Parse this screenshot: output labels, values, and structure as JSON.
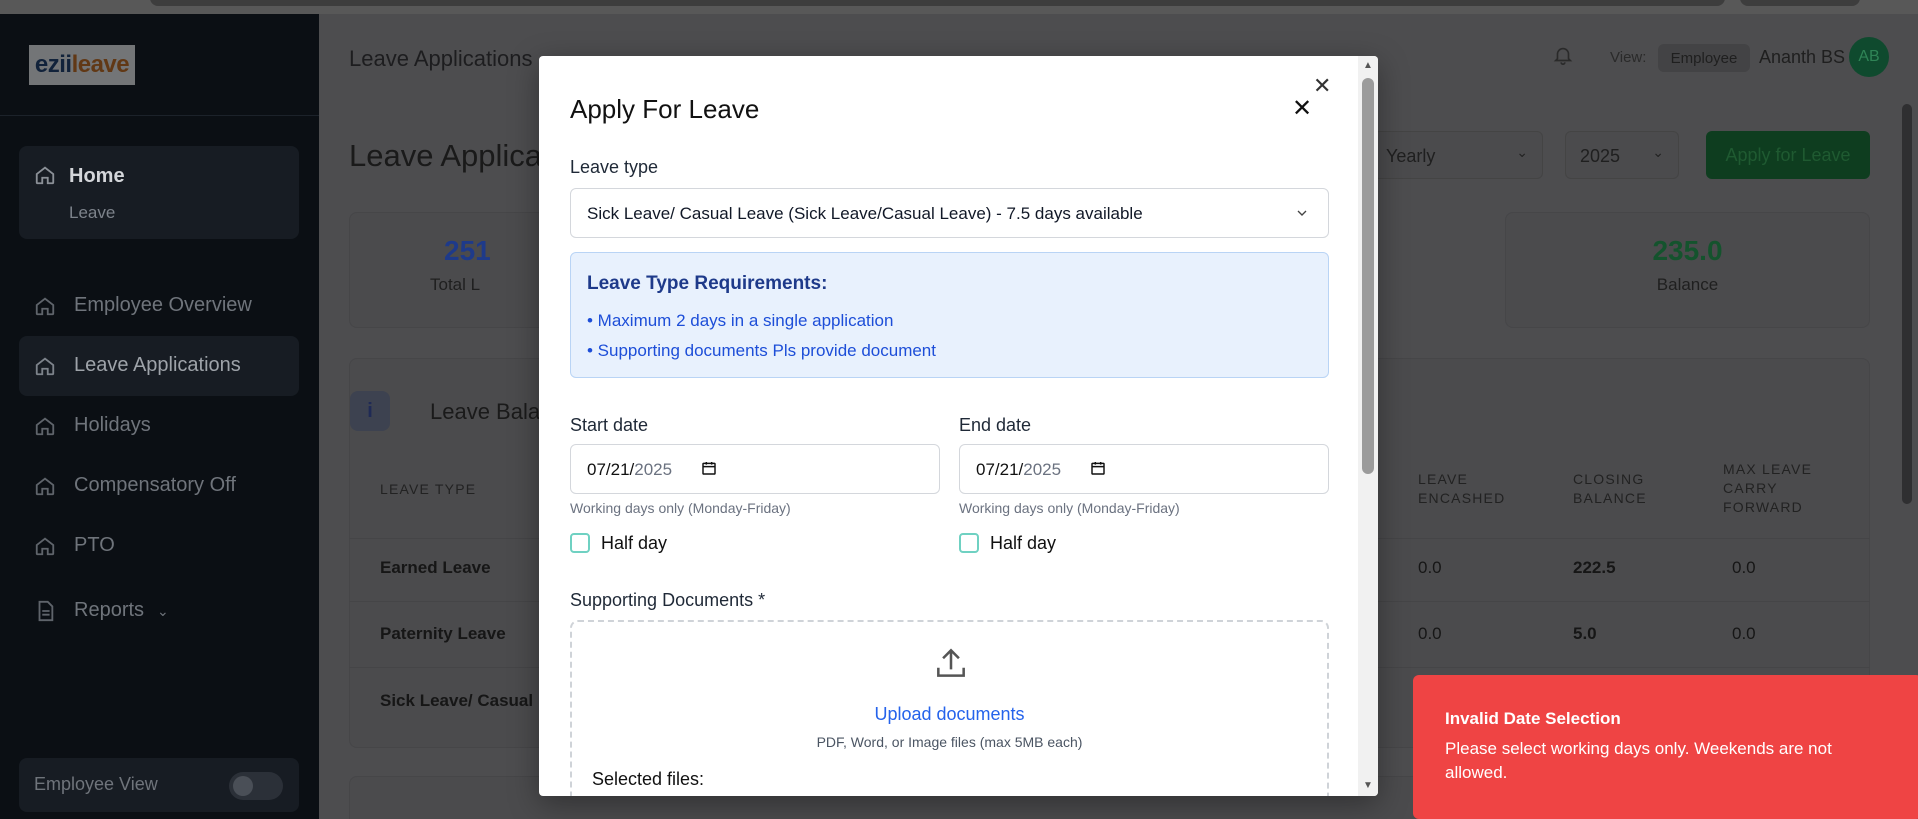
{
  "app": {
    "logo_text": "ezii",
    "logo_accent": "leave"
  },
  "sidebar": {
    "home_label": "Home",
    "home_sub": "Leave",
    "items": [
      {
        "label": "Employee Overview",
        "icon": "home-icon"
      },
      {
        "label": "Leave Applications",
        "icon": "home-icon"
      },
      {
        "label": "Holidays",
        "icon": "home-icon"
      },
      {
        "label": "Compensatory Off",
        "icon": "home-icon"
      },
      {
        "label": "PTO",
        "icon": "home-icon"
      },
      {
        "label": "Reports",
        "icon": "document-icon"
      }
    ],
    "employee_view_label": "Employee View"
  },
  "header": {
    "title": "Leave Applications",
    "view_label": "View:",
    "view_value": "Employee",
    "user_name": "Ananth BS",
    "avatar_initials": "AB"
  },
  "page": {
    "title": "Leave Applicat",
    "period_select": "Yearly",
    "year_select": "2025",
    "apply_button": "Apply for Leave",
    "stats": [
      {
        "value": "251",
        "label": "Total L",
        "color": "#1e3a8a"
      },
      {
        "value": "235.0",
        "label": "Balance",
        "color": "#14532d"
      }
    ],
    "balance_panel_title": "Leave Balan",
    "columns": [
      "LEAVE TYPE",
      "LEAVE ENCASHED",
      "CLOSING BALANCE",
      "MAX LEAVE CARRY FORWARD"
    ],
    "rows": [
      {
        "type": "Earned Leave",
        "encashed": "0.0",
        "closing": "222.5",
        "carry": "0.0"
      },
      {
        "type": "Paternity Leave",
        "encashed": "0.0",
        "closing": "5.0",
        "carry": "0.0"
      },
      {
        "type": "Sick Leave/ Casual L",
        "encashed": "",
        "closing": "",
        "carry": ""
      }
    ]
  },
  "modal": {
    "title": "Apply For Leave",
    "leave_type_label": "Leave type",
    "leave_type_value": "Sick Leave/ Casual Leave (Sick Leave/Casual Leave) - 7.5 days available",
    "requirements_title": "Leave Type Requirements:",
    "requirements": [
      "• Maximum 2 days in a single application",
      "• Supporting documents Pls provide document"
    ],
    "start_date_label": "Start date",
    "start_date_md": "07/21/",
    "start_date_year": "2025",
    "end_date_label": "End date",
    "end_date_md": "07/21/",
    "end_date_year": "2025",
    "working_days_hint": "Working days only (Monday-Friday)",
    "half_day_label": "Half day",
    "supporting_docs_label": "Supporting Documents *",
    "upload_link": "Upload documents",
    "upload_hint": "PDF, Word, or Image files (max 5MB each)",
    "selected_files_label": "Selected files:"
  },
  "toast": {
    "title": "Invalid Date Selection",
    "message": "Please select working days only. Weekends are not allowed.",
    "color": "#ef4444"
  }
}
